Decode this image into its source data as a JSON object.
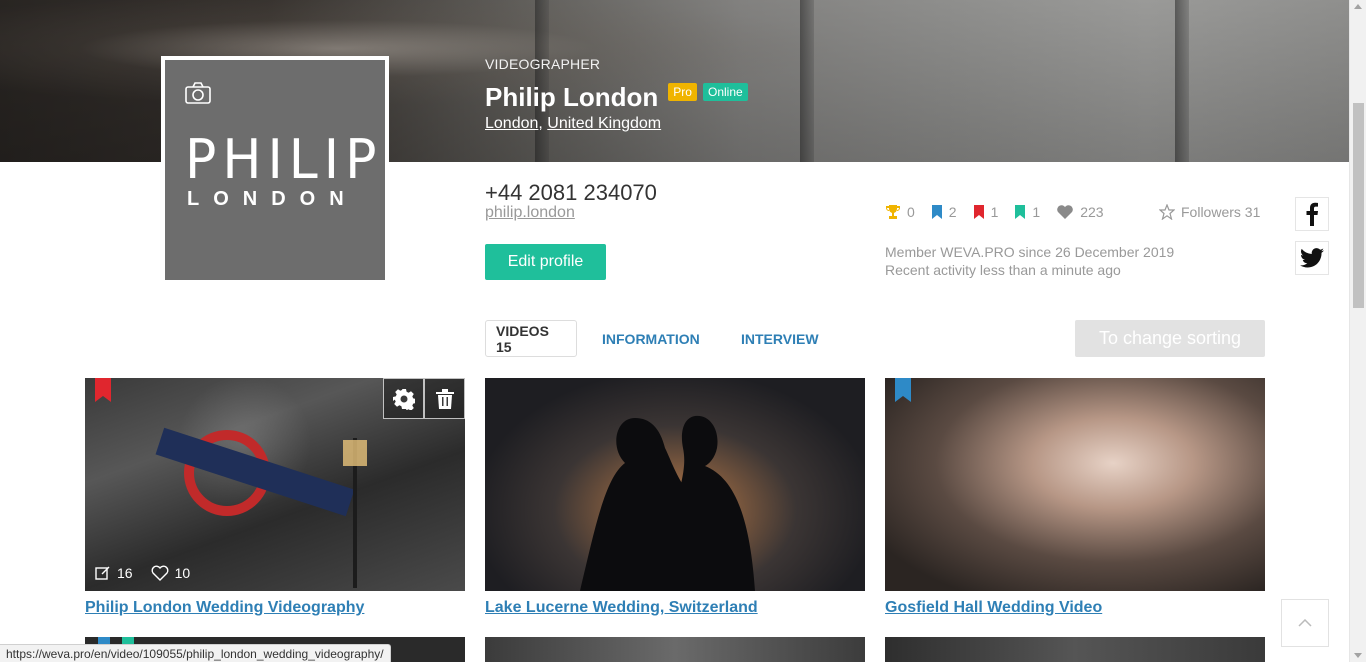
{
  "profile": {
    "role": "VIDEOGRAPHER",
    "name": "Philip London",
    "badge_pro": "Pro",
    "badge_online": "Online",
    "city": "London",
    "country": "United Kingdom",
    "logo_line1": "PHILIP",
    "logo_line2": "LONDON",
    "phone": "+44 2081 234070",
    "website": "philip.london",
    "edit_label": "Edit profile"
  },
  "stats": {
    "awards": "0",
    "blue_bookmarks": "2",
    "red_bookmarks": "1",
    "green_bookmarks": "1",
    "likes": "223",
    "followers_label": "Followers 31",
    "member_since": "Member WEVA.PRO since 26 December 2019",
    "recent_activity": "Recent activity less than a minute ago"
  },
  "tabs": [
    {
      "label": "VIDEOS 15",
      "active": true
    },
    {
      "label": "INFORMATION",
      "active": false
    },
    {
      "label": "INTERVIEW",
      "active": false
    }
  ],
  "sort_label": "To change sorting",
  "videos": [
    {
      "title": "Philip London Wedding Videography",
      "comments": "16",
      "likes": "10",
      "ribbon_color": "#e0262e"
    },
    {
      "title": "Lake Lucerne Wedding, Switzerland"
    },
    {
      "title": "Gosfield Hall Wedding Video",
      "ribbon_color": "#2e8ac7"
    }
  ],
  "status_url": "https://weva.pro/en/video/109055/philip_london_wedding_videography/",
  "colors": {
    "accent": "#1fbf9b",
    "link": "#2e7fb5",
    "pro": "#f0b400",
    "award": "#f0b400",
    "bookmark_blue": "#2e8ac7",
    "bookmark_red": "#e0262e",
    "bookmark_green": "#1fbf9b"
  },
  "icons": [
    "camera-icon",
    "trophy-icon",
    "bookmark-icon",
    "heart-icon",
    "star-icon",
    "facebook-icon",
    "twitter-icon",
    "gear-icon",
    "trash-icon",
    "edit-icon",
    "chevron-up-icon"
  ]
}
